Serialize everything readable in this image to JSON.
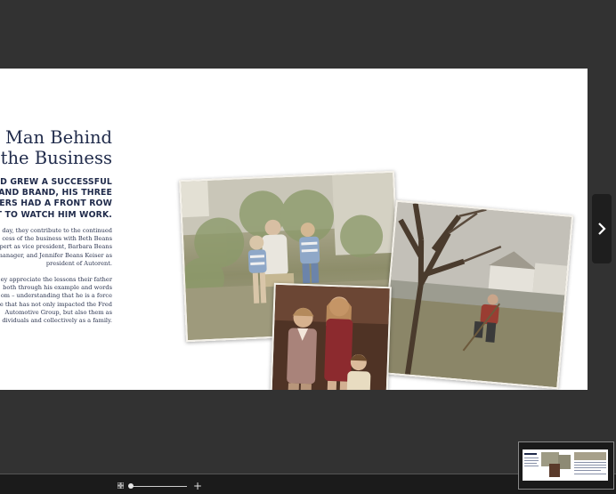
{
  "article": {
    "title_line1": "e Man Behind",
    "title_line2": "the Business",
    "intro_line1": "FRED GREW A SUCCESSFUL",
    "intro_line2": "ESS AND BRAND, HIS THREE",
    "intro_line3": "GHTERS HAD A FRONT ROW",
    "intro_line4": "SEAT TO WATCH HIM WORK.",
    "p1_line1": "day, they contribute to the continued",
    "p1_line2": "cess of the business with Beth Beans",
    "p1_line3": "pert as vice president, Barbara Beans",
    "p1_line4": "manager, and Jennifer Beans Keiser as",
    "p1_line5": "president of Autorent.",
    "p2_line1": "ey appreciate the lessons their father",
    "p2_line2": "both through his example and words",
    "p2_line3": "om – understanding that he is a force",
    "p2_line4": "e that has not only impacted the Fred",
    "p2_line5": "Automotive Group, but also them as",
    "p2_line6": "dividuals and collectively as a family."
  },
  "icons": {
    "next": "chevron-right-icon",
    "grid": "grid-icon",
    "zoom_in": "plus-icon"
  },
  "controls": {
    "zoom_plus": "+"
  },
  "colors": {
    "background": "#323232",
    "page": "#ffffff",
    "heading": "#1f2a4a"
  }
}
